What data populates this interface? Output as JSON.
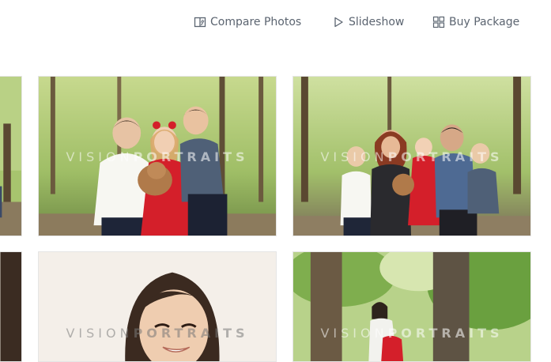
{
  "toolbar": {
    "compare": {
      "label": "Compare Photos",
      "icon": "compare-icon"
    },
    "slideshow": {
      "label": "Slideshow",
      "icon": "play-icon"
    },
    "buy": {
      "label": "Buy Package",
      "icon": "package-icon"
    }
  },
  "gallery": {
    "watermark": {
      "light": "VISION",
      "bold": "PORTRAITS"
    },
    "photos": [
      {
        "id": "left-top"
      },
      {
        "id": "family-kids"
      },
      {
        "id": "family-all"
      },
      {
        "id": "left-bottom"
      },
      {
        "id": "girl-portrait"
      },
      {
        "id": "tree"
      }
    ]
  },
  "colors": {
    "toolbar_text": "#5b6470",
    "foliage": "#8fb85a",
    "dress_red": "#d41f2a"
  }
}
